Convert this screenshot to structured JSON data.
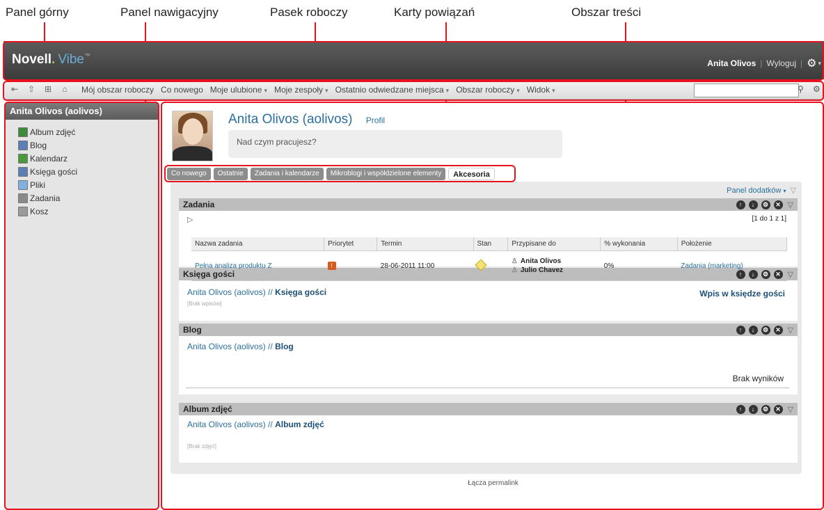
{
  "annotations": {
    "top_panel": "Panel górny",
    "nav_panel": "Panel nawigacyjny",
    "workspace_bar": "Pasek roboczy",
    "tabs": "Karty powiązań",
    "content": "Obszar treści"
  },
  "header": {
    "logo_brand": "Novell",
    "logo_dot": ".",
    "logo_product": "Vibe",
    "logo_tm": "™",
    "user": "Anita Olivos",
    "sep": "|",
    "logout": "Wyloguj",
    "sep2": "|"
  },
  "toolbar": {
    "items": [
      {
        "label": "Mój obszar roboczy",
        "arrow": ""
      },
      {
        "label": "Co nowego",
        "arrow": ""
      },
      {
        "label": "Moje ulubione",
        "arrow": "▾"
      },
      {
        "label": "Moje zespoły",
        "arrow": "▾"
      },
      {
        "label": "Ostatnio odwiedzane miejsca",
        "arrow": "▾"
      },
      {
        "label": "Obszar roboczy",
        "arrow": "▾"
      },
      {
        "label": "Widok",
        "arrow": "▾"
      }
    ],
    "search_value": ""
  },
  "sidebar": {
    "title": "Anita Olivos (aolivos)",
    "items": [
      {
        "label": "Album zdjęć",
        "icon": "photo-album-icon",
        "color": "#3c8c3c"
      },
      {
        "label": "Blog",
        "icon": "blog-icon",
        "color": "#5b7fb5"
      },
      {
        "label": "Kalendarz",
        "icon": "calendar-icon",
        "color": "#4a9a3c"
      },
      {
        "label": "Księga gości",
        "icon": "guestbook-icon",
        "color": "#5b7fb5"
      },
      {
        "label": "Pliki",
        "icon": "files-icon",
        "color": "#7fb0e0"
      },
      {
        "label": "Zadania",
        "icon": "tasks-icon",
        "color": "#8a8a8a"
      },
      {
        "label": "Kosz",
        "icon": "trash-icon",
        "color": "#9a9a9a"
      }
    ]
  },
  "profile": {
    "name": "Anita Olivos (aolivos)",
    "profile_link": "Profil",
    "status_placeholder": "Nad czym pracujesz?"
  },
  "tabs": [
    {
      "label": "Co nowego",
      "active": false
    },
    {
      "label": "Ostatnie",
      "active": false
    },
    {
      "label": "Zadania i kalendarze",
      "active": false
    },
    {
      "label": "Mikroblogi i współdzielone elementy",
      "active": false
    },
    {
      "label": "Akcesoria",
      "active": true
    }
  ],
  "addons": {
    "label": "Panel dodatków"
  },
  "panels": {
    "tasks": {
      "title": "Zadania",
      "pager": "[1 do 1 z 1]",
      "columns": [
        "Nazwa zadania",
        "Priorytet",
        "Termin",
        "Stan",
        "Przypisane do",
        "% wykonania",
        "Położenie"
      ],
      "rows": [
        {
          "name": "Pełna analiza produktu Z",
          "priority": "!",
          "due": "28-06-2011 11:00",
          "assignees": [
            "Anita Olivos",
            "Julio Chavez"
          ],
          "percent": "0%",
          "location": "Zadania (marketing)"
        }
      ]
    },
    "guestbook": {
      "title": "Księga gości",
      "crumb_user": "Anita Olivos (aolivos)",
      "crumb_sep": " // ",
      "crumb_target": "Księga gości",
      "empty": "[Brak wpisów]",
      "action": "Wpis w księdze gości"
    },
    "blog": {
      "title": "Blog",
      "crumb_user": "Anita Olivos (aolivos)",
      "crumb_sep": " // ",
      "crumb_target": "Blog",
      "no_results": "Brak wyników"
    },
    "album": {
      "title": "Album zdjęć",
      "crumb_user": "Anita Olivos (aolivos)",
      "crumb_sep": " // ",
      "crumb_target": "Album zdjęć",
      "empty": "[Brak zdjęć]"
    }
  },
  "footer": {
    "permalink": "Łącza permalink"
  },
  "colors": {
    "annotation": "#e8121e",
    "link": "#2a6f9e",
    "header_bg": "#4a4a4a"
  }
}
